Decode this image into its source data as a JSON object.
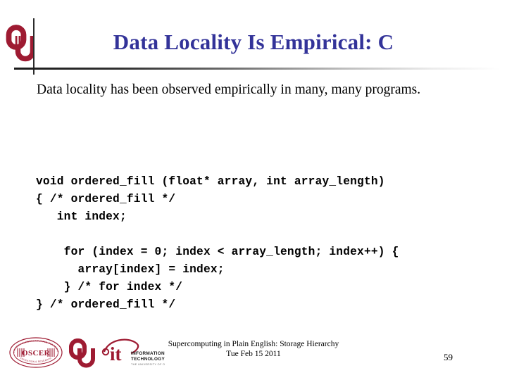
{
  "slide": {
    "title": "Data Locality Is Empirical: C",
    "title_color": "#333399",
    "background_color": "#ffffff",
    "page_number": "59"
  },
  "header": {
    "ou_logo_label": "OU",
    "divider_color": "#1a1a1a"
  },
  "body": {
    "bullet_line_1": "Data locality has been observed empirically in many, many",
    "bullet_line_2": "programs.",
    "text_color": "#000000"
  },
  "code": {
    "block_1": "void ordered_fill (float* array, int array_length)\n{ /* ordered_fill */\n   int index;",
    "block_2": "    for (index = 0; index < array_length; index++) {\n      array[index] = index;\n    } /* for index */\n} /* ordered_fill */"
  },
  "footer": {
    "line_1": "Supercomputing in Plain English: Storage Hierarchy",
    "line_2": "Tue Feb 15 2011",
    "oscer_label": "OSCER",
    "oscer_ring_top": "OKLAHOMA SUPERCOMPUTING CENTER FOR",
    "oscer_ring_bottom": "EDUCATION & RESEARCH",
    "ou_label": "OU",
    "it_label": "it",
    "it_line_1": "INFORMATION",
    "it_line_2": "TECHNOLOGY",
    "it_line_3": "THE UNIVERSITY OF OKLAHOMA",
    "crimson": "#9e1b32"
  }
}
